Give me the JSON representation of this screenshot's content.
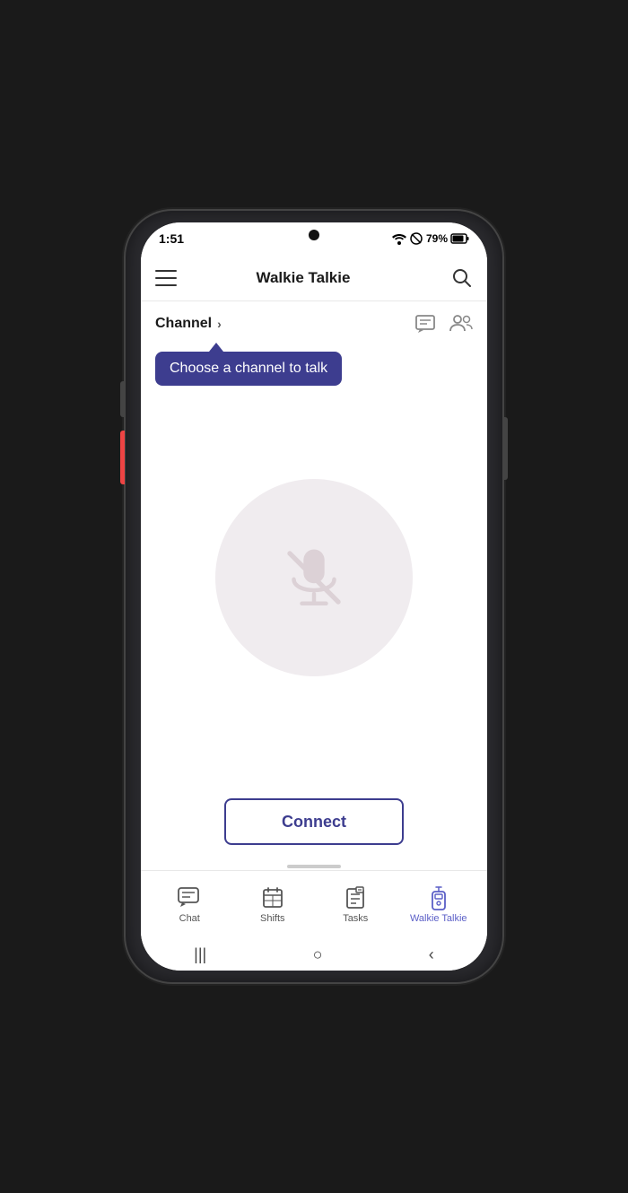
{
  "status_bar": {
    "time": "1:51",
    "battery": "79%",
    "icons": "📶🔇79%🔋"
  },
  "header": {
    "title": "Walkie Talkie",
    "hamburger_label": "Menu",
    "search_label": "Search"
  },
  "channel": {
    "label": "Channel",
    "chevron": "›",
    "tooltip": "Choose a channel to talk",
    "action_chat": "Chat icon",
    "action_people": "People icon"
  },
  "mic": {
    "state": "muted"
  },
  "connect": {
    "button_label": "Connect"
  },
  "bottom_nav": {
    "items": [
      {
        "label": "Chat",
        "icon": "chat",
        "active": false
      },
      {
        "label": "Shifts",
        "icon": "shifts",
        "active": false
      },
      {
        "label": "Tasks",
        "icon": "tasks",
        "active": false
      },
      {
        "label": "Walkie Talkie",
        "icon": "walkie",
        "active": true
      }
    ]
  },
  "colors": {
    "accent": "#5b5fc7",
    "tooltip_bg": "#3d3d8f",
    "mic_circle": "#f0ecef"
  }
}
